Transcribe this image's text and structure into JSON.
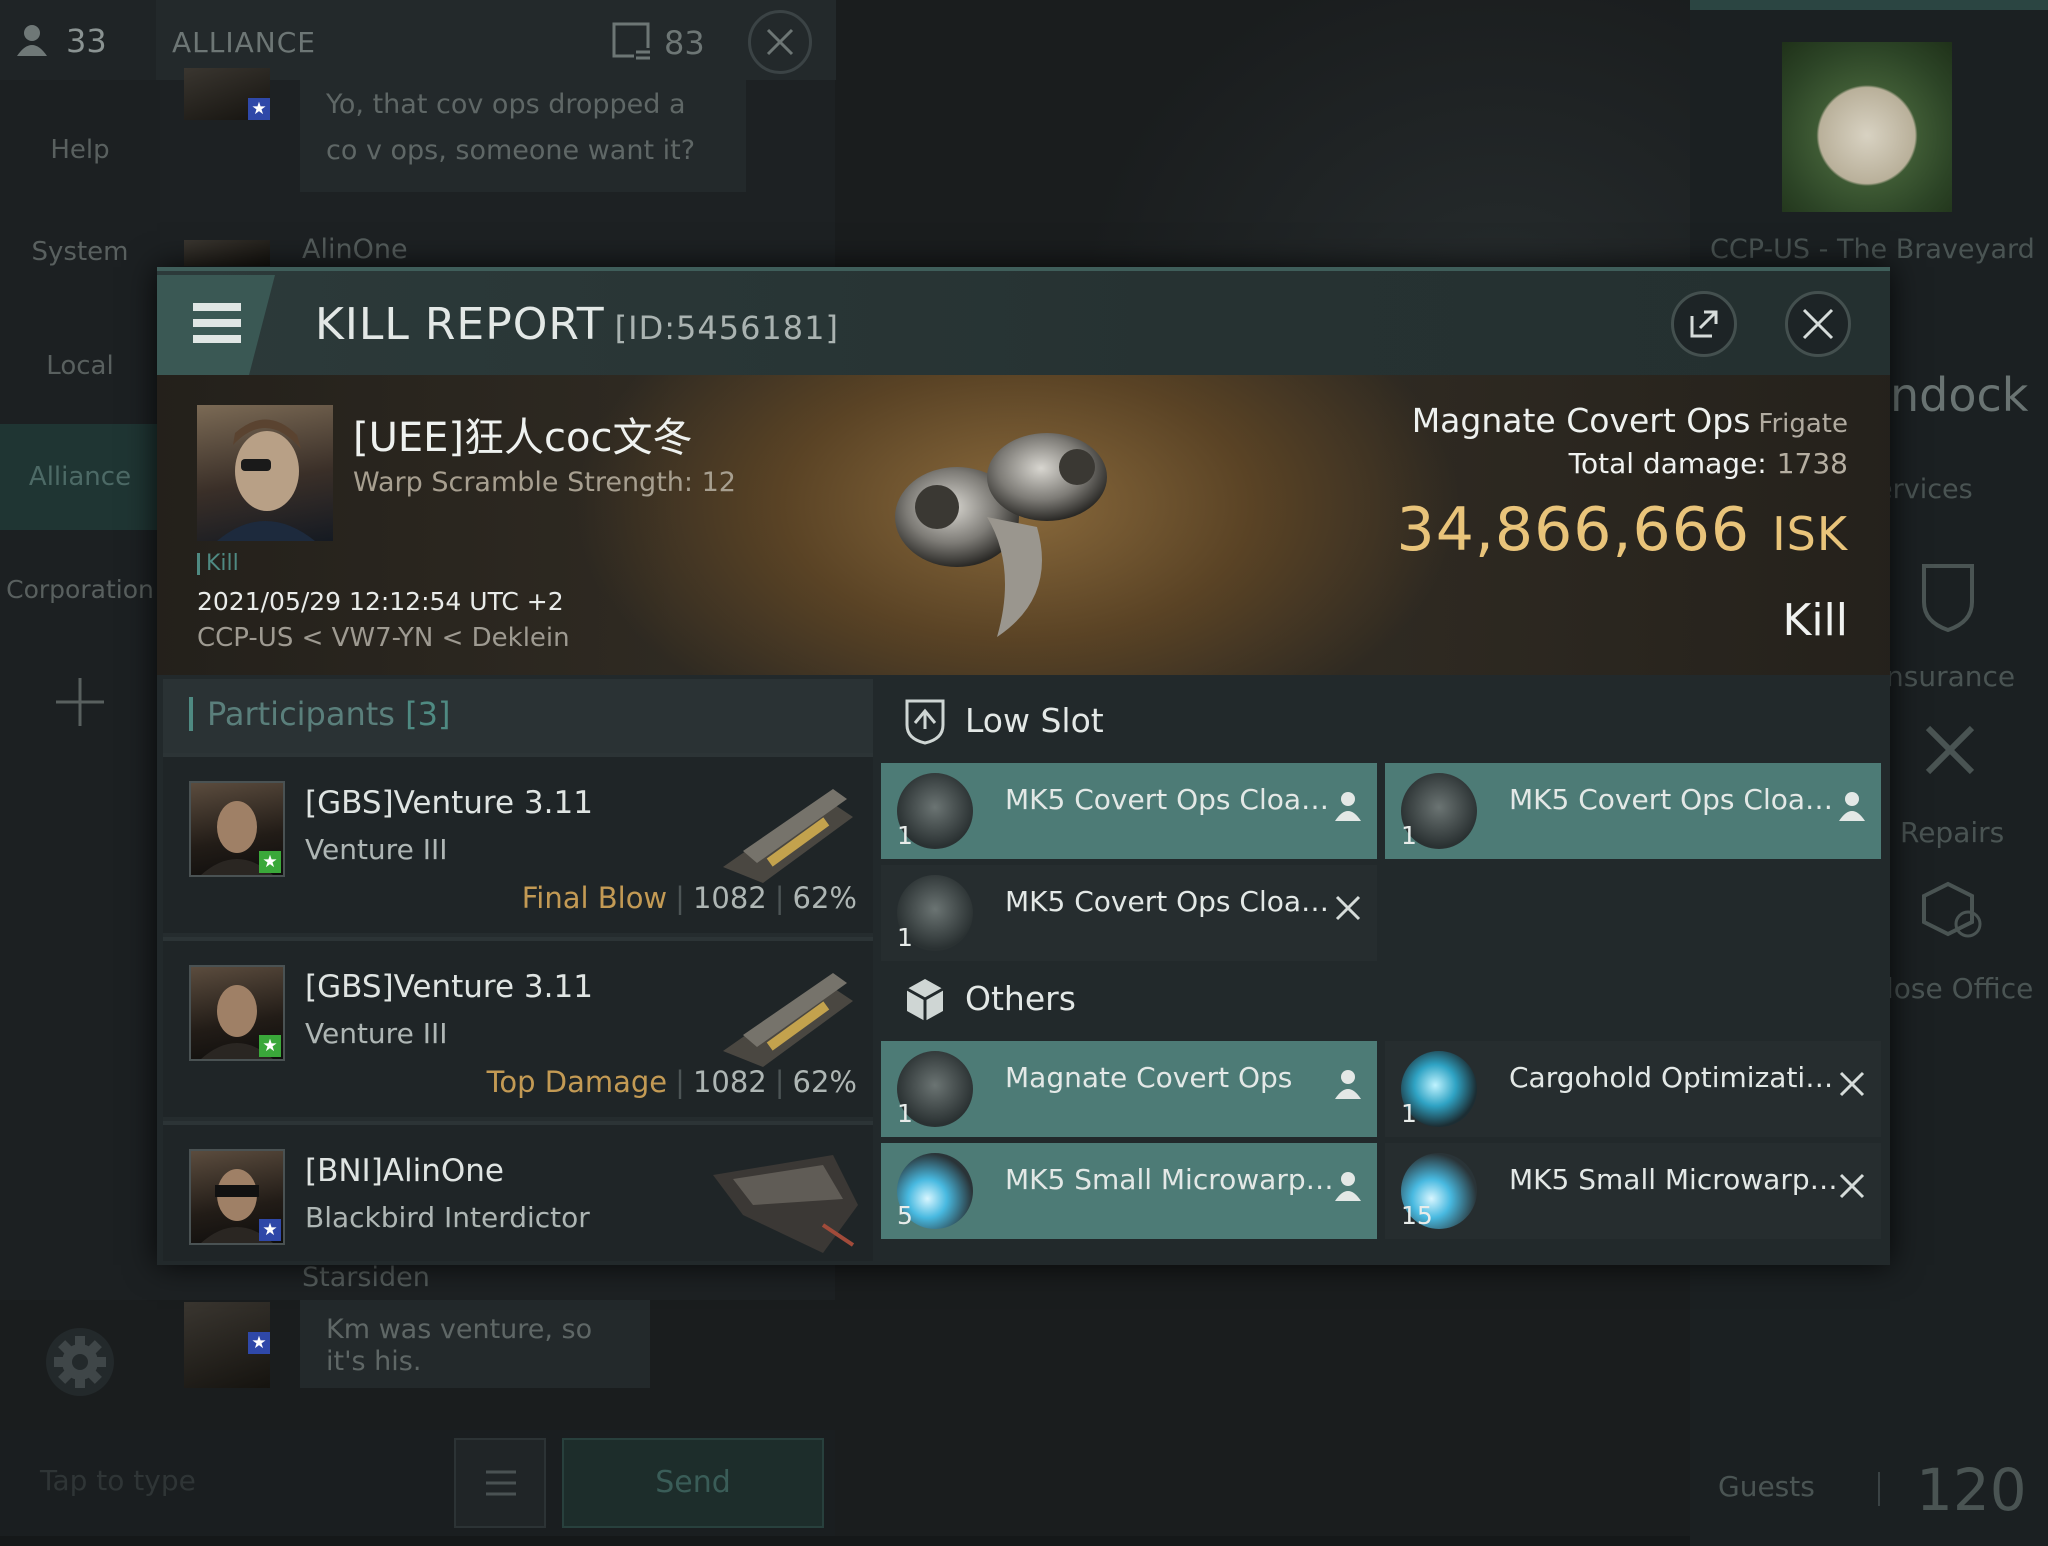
{
  "chat": {
    "member_count": "33",
    "channel_name": "ALLIANCE",
    "message_count": "83",
    "nav": [
      "Help",
      "System",
      "Local",
      "Alliance",
      "Corporation"
    ],
    "messages": [
      {
        "author": "",
        "text": "Yo, that cov ops dropped a co v ops, someone want it?"
      },
      {
        "author": "AlinOne",
        "text": ""
      },
      {
        "author": "Starsiden",
        "text": "Km was venture, so it's his."
      }
    ],
    "input_placeholder": "Tap to type",
    "send_label": "Send"
  },
  "right_panel": {
    "station_name": "CCP-US - The Braveyard",
    "undock_label": "ndock",
    "services_label": "ervices",
    "insurance_label": "nsurance",
    "repairs_label": "Repairs",
    "office_label": "lose Office",
    "guests_label": "Guests",
    "guests_count": "120"
  },
  "report": {
    "title": "KILL REPORT",
    "id_label": "[ID:5456181]",
    "victim_name": "[UEE]狂人coc文冬",
    "warp_scramble": "Warp Scramble Strength: 12",
    "kill_tag": "Kill",
    "datetime": "2021/05/29 12:12:54 UTC +2",
    "location": "CCP-US < VW7-YN < Deklein",
    "ship_name": "Magnate Covert Ops",
    "ship_class": "Frigate",
    "total_damage_label": "Total damage:",
    "total_damage": "1738",
    "isk_value": "34,866,666",
    "isk_unit": "ISK",
    "result": "Kill"
  },
  "participants": {
    "label": "Participants",
    "count": "[3]",
    "rows": [
      {
        "name": "[GBS]Venture 3.11",
        "ship": "Venture III",
        "tag": "Final Blow",
        "damage": "1082",
        "percent": "62%",
        "badge_color": "#3aa83a"
      },
      {
        "name": "[GBS]Venture 3.11",
        "ship": "Venture III",
        "tag": "Top Damage",
        "damage": "1082",
        "percent": "62%",
        "badge_color": "#3aa83a"
      },
      {
        "name": "[BNI]AlinOne",
        "ship": "Blackbird Interdictor",
        "tag": "",
        "damage": "",
        "percent": "",
        "badge_color": "#2f48a8"
      }
    ]
  },
  "low_slot": {
    "label": "Low Slot",
    "items": [
      {
        "name": "MK5 Covert Ops Cloaking...",
        "qty": "1",
        "status": "dropped",
        "icon": "cloak-module-icon"
      },
      {
        "name": "MK5 Covert Ops Cloaking...",
        "qty": "1",
        "status": "dropped",
        "icon": "cloak-module-icon"
      },
      {
        "name": "MK5 Covert Ops Cloaking...",
        "qty": "1",
        "status": "destroyed",
        "icon": "cloak-module-icon"
      }
    ]
  },
  "others": {
    "label": "Others",
    "items": [
      {
        "name": "Magnate Covert Ops",
        "qty": "1",
        "status": "dropped",
        "icon": "ship-icon"
      },
      {
        "name": "Cargohold Optimization I",
        "qty": "1",
        "status": "destroyed",
        "icon": "cargohold-rig-icon"
      },
      {
        "name": "MK5 Small Microwarpdrive",
        "qty": "5",
        "status": "dropped",
        "icon": "microwarpdrive-icon"
      },
      {
        "name": "MK5 Small Microwarpdrive",
        "qty": "15",
        "status": "destroyed",
        "icon": "microwarpdrive-icon"
      }
    ]
  }
}
